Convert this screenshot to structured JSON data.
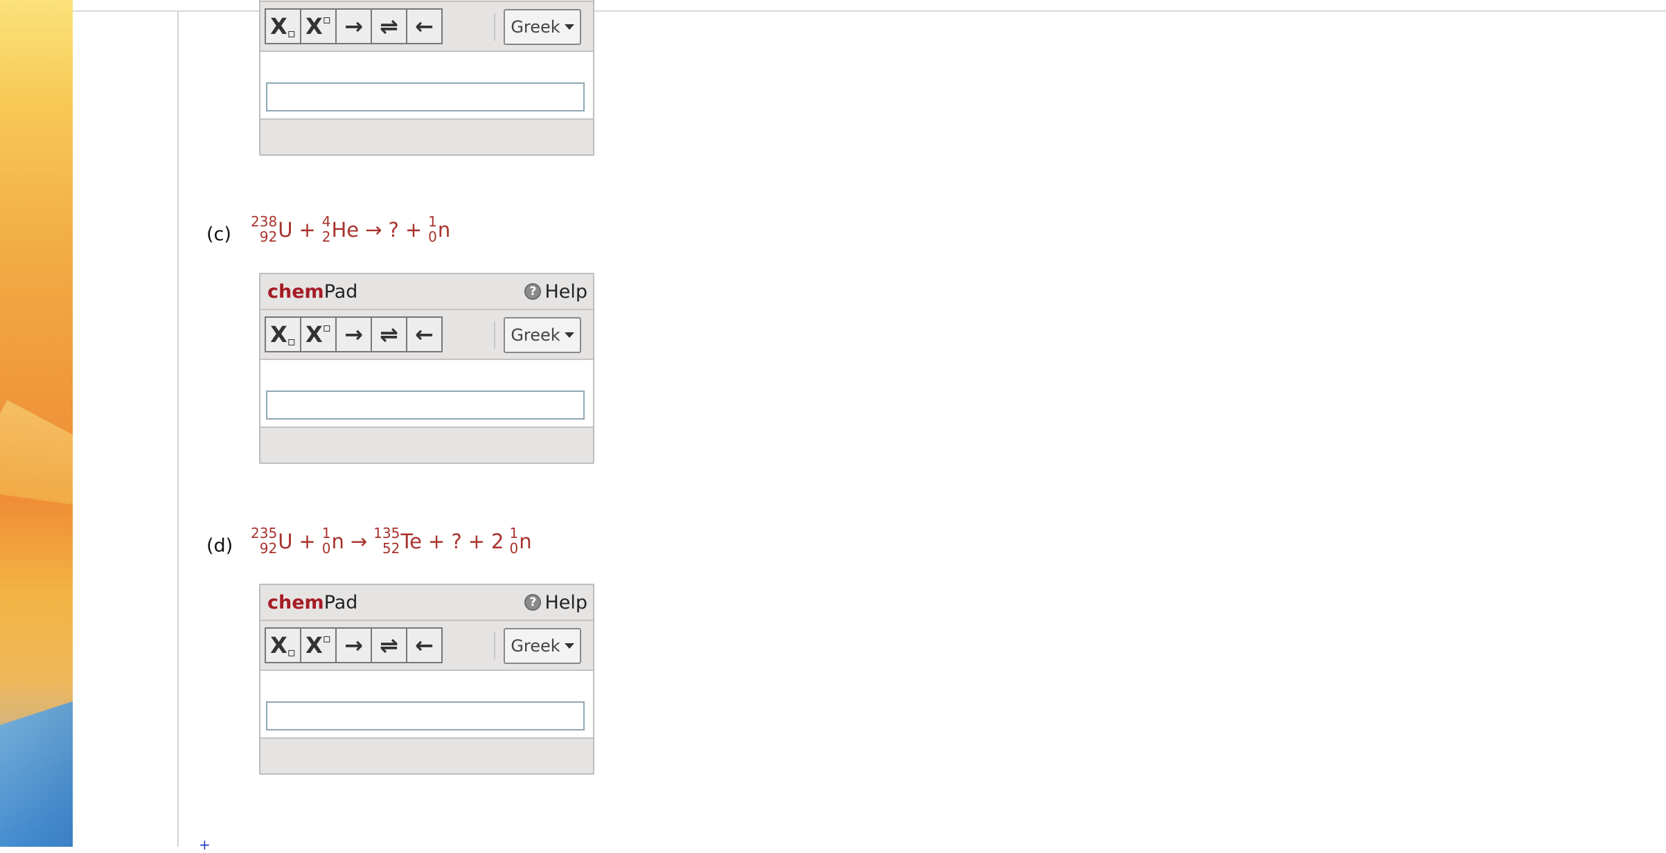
{
  "chempad": {
    "brand_bold": "chem",
    "brand_rest": "Pad",
    "help_label": "Help",
    "help_icon_glyph": "?",
    "greek_label": "Greek",
    "tools": {
      "subscript": "X",
      "superscript": "X",
      "arrow_right": "→",
      "equilibrium": "⇌",
      "arrow_left": "←"
    },
    "answer_value": ""
  },
  "questions": [
    {
      "label": "(c)",
      "equation": {
        "n1_mass": "238",
        "n1_atomic": "92",
        "n1_sym": "U",
        "op1": "+",
        "n2_mass": "4",
        "n2_atomic": "2",
        "n2_sym": "He",
        "arrow": "→",
        "unknown": "?",
        "op2": "+",
        "n3_mass": "1",
        "n3_atomic": "0",
        "n3_sym": "n"
      }
    },
    {
      "label": "(d)",
      "equation": {
        "n1_mass": "235",
        "n1_atomic": "92",
        "n1_sym": "U",
        "op1": "+",
        "n2_mass": "1",
        "n2_atomic": "0",
        "n2_sym": "n",
        "arrow": "→",
        "n3_mass": "135",
        "n3_atomic": "52",
        "n3_sym": "Te",
        "op2": "+",
        "unknown": "?",
        "op3": "+",
        "coef": "2",
        "n4_mass": "1",
        "n4_atomic": "0",
        "n4_sym": "n"
      }
    }
  ],
  "footer_mark": "+",
  "colors": {
    "equation_red": "#a8322d",
    "brand_red": "#a51c25",
    "widget_gray": "#e6e3e3"
  }
}
